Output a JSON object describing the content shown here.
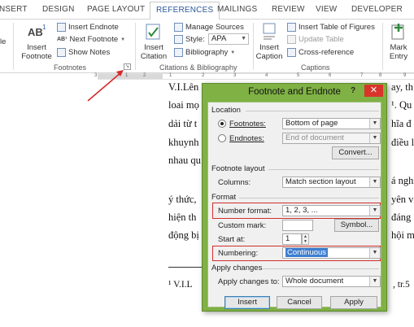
{
  "ribbon": {
    "tabs": [
      "NSERT",
      "DESIGN",
      "PAGE LAYOUT",
      "REFERENCES",
      "MAILINGS",
      "REVIEW",
      "VIEW",
      "DEVELOPER"
    ],
    "active_tab": "REFERENCES",
    "left_clip": "le",
    "footnotes_group": {
      "label": "Footnotes",
      "insert_footnote": "Insert Footnote",
      "insert_endnote": "Insert Endnote",
      "next_footnote": "Next Footnote",
      "show_notes": "Show Notes"
    },
    "citations_group": {
      "label": "Citations & Bibliography",
      "insert_citation": "Insert Citation",
      "manage_sources": "Manage Sources",
      "style_label": "Style:",
      "style_value": "APA",
      "bibliography": "Bibliography"
    },
    "captions_group": {
      "label": "Captions",
      "insert_caption": "Insert Caption",
      "insert_table_of_figures": "Insert Table of Figures",
      "update_table": "Update Table",
      "cross_reference": "Cross-reference"
    },
    "mark_entry": "Mark Entry"
  },
  "ruler": {
    "marks": [
      "3",
      "1",
      "2",
      "1",
      "2",
      "3",
      "4",
      "5",
      "6",
      "7",
      "8",
      "9"
    ]
  },
  "document": {
    "lines_left": [
      "V.I.Lên",
      "loai mọ",
      "dải từ t",
      "khuynh",
      "nhau qu",
      "ý thức,",
      "hiện th",
      "động bị"
    ],
    "lines_right": [
      "ay, th",
      "¹. Qu",
      "hĩa đ",
      "điều l",
      "á nghi",
      "yên v",
      "đáng",
      "hội m"
    ],
    "footnote_left": "¹ V.I.L",
    "footnote_right": ", tr.5"
  },
  "dialog": {
    "title": "Footnote and Endnote",
    "help": "?",
    "close": "✕",
    "location": {
      "title": "Location",
      "footnotes_label": "Footnotes:",
      "footnotes_value": "Bottom of page",
      "endnotes_label": "Endnotes:",
      "endnotes_value": "End of document",
      "convert": "Convert..."
    },
    "layout": {
      "title": "Footnote layout",
      "columns_label": "Columns:",
      "columns_value": "Match section layout"
    },
    "format": {
      "title": "Format",
      "number_format_label": "Number format:",
      "number_format_value": "1, 2, 3, ...",
      "custom_mark_label": "Custom mark:",
      "symbol": "Symbol...",
      "start_at_label": "Start at:",
      "start_at_value": "1",
      "numbering_label": "Numbering:",
      "numbering_value": "Continuous"
    },
    "apply": {
      "title": "Apply changes",
      "apply_to_label": "Apply changes to:",
      "apply_to_value": "Whole document"
    },
    "buttons": {
      "insert": "Insert",
      "cancel": "Cancel",
      "apply": "Apply"
    }
  },
  "colors": {
    "accent": "#2b579a",
    "dialog_frame": "#7fb144",
    "highlight": "#d32c2c",
    "arrow": "#d62a2a"
  }
}
